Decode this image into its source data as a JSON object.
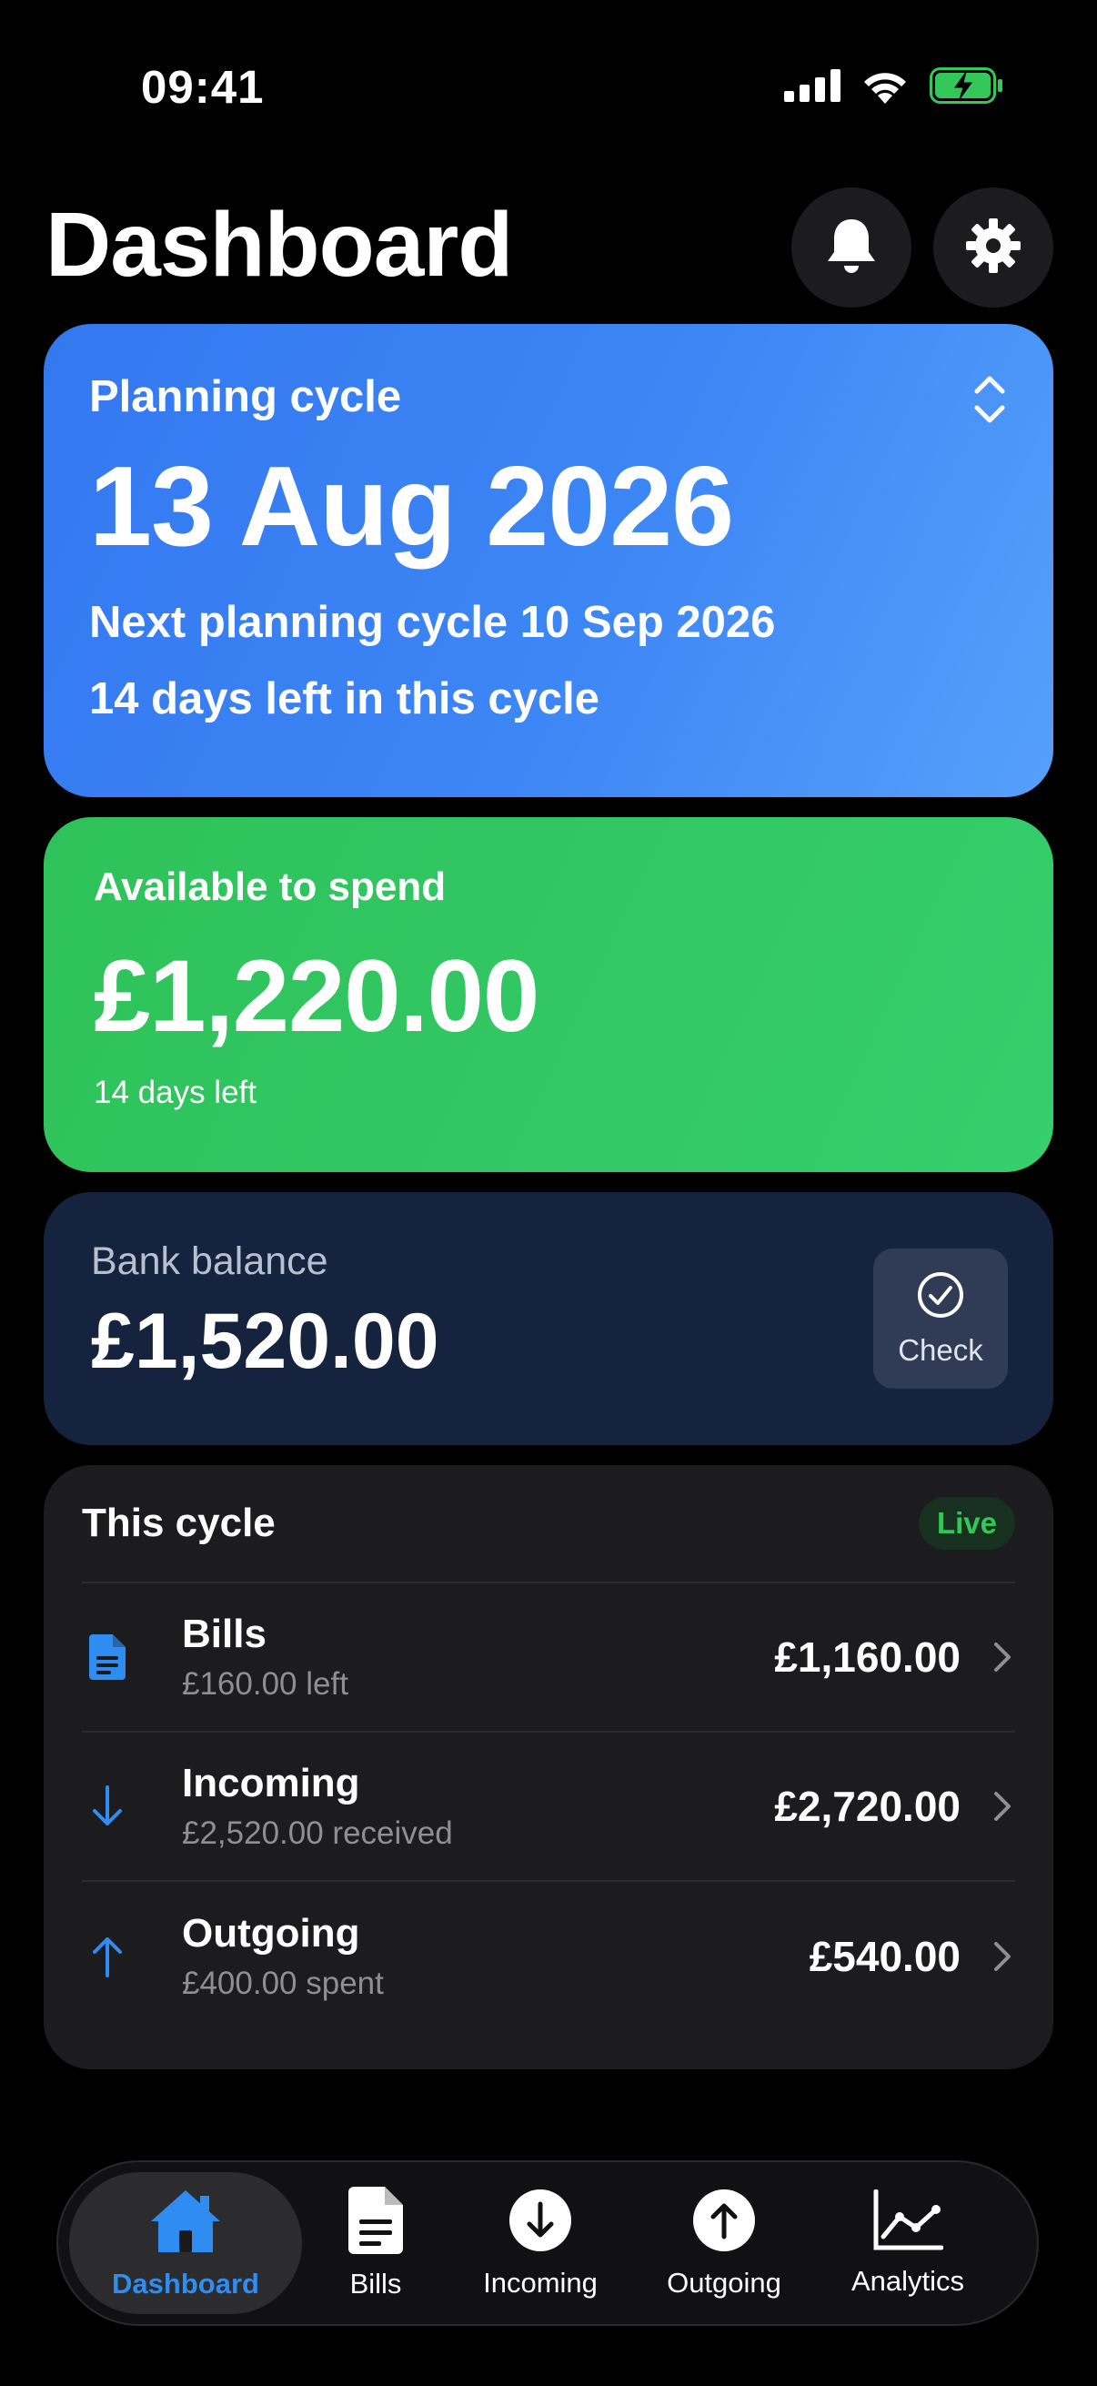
{
  "status_bar": {
    "time": "09:41"
  },
  "header": {
    "title": "Dashboard"
  },
  "cycle_card": {
    "label": "Planning cycle",
    "date": "13 Aug 2026",
    "next": "Next planning cycle 10 Sep 2026",
    "days_left": "14 days left in this cycle"
  },
  "spend_card": {
    "label": "Available to spend",
    "amount": "£1,220.00",
    "days_left": "14 days left"
  },
  "bank_card": {
    "label": "Bank balance",
    "amount": "£1,520.00",
    "check_label": "Check"
  },
  "summary": {
    "title": "This cycle",
    "badge": "Live",
    "rows": [
      {
        "title": "Bills",
        "sub": "£160.00 left",
        "amount": "£1,160.00"
      },
      {
        "title": "Incoming",
        "sub": "£2,520.00 received",
        "amount": "£2,720.00"
      },
      {
        "title": "Outgoing",
        "sub": "£400.00 spent",
        "amount": "£540.00"
      }
    ]
  },
  "tabs": [
    {
      "label": "Dashboard",
      "icon": "house-icon",
      "active": true
    },
    {
      "label": "Bills",
      "icon": "document-icon"
    },
    {
      "label": "Incoming",
      "icon": "arrow-down-circle-icon"
    },
    {
      "label": "Outgoing",
      "icon": "arrow-up-circle-icon"
    },
    {
      "label": "Analytics",
      "icon": "chart-line-icon"
    }
  ],
  "colors": {
    "accent_blue": "#2f8cf0",
    "cycle_card": "#3d86f5",
    "spend_card": "#32c865",
    "bank_card": "#16233f",
    "live_green": "#33c759"
  }
}
